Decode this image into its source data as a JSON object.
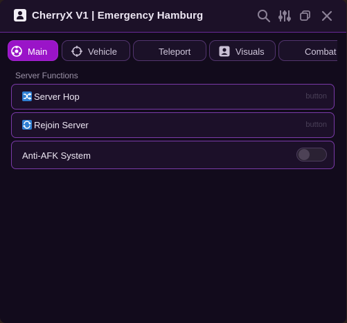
{
  "window": {
    "title": "CherryX V1 | Emergency Hamburg",
    "accent_color": "#9a14c8"
  },
  "titlebar_icons": [
    "search-icon",
    "settings-sliders-icon",
    "minimize-icon",
    "close-icon"
  ],
  "tabs": [
    {
      "label": "Main",
      "icon": "main-icon",
      "active": true
    },
    {
      "label": "Vehicle",
      "icon": "crosshair-icon",
      "active": false
    },
    {
      "label": "Teleport",
      "icon": "",
      "active": false
    },
    {
      "label": "Visuals",
      "icon": "user-card-icon",
      "active": false
    },
    {
      "label": "Combat",
      "icon": "",
      "active": false
    }
  ],
  "section": {
    "title": "Server Functions",
    "items": [
      {
        "label": "Server Hop",
        "type_hint": "button",
        "emoji": "shuffle-emoji-icon"
      },
      {
        "label": "Rejoin Server",
        "type_hint": "button",
        "emoji": "repeat-emoji-icon"
      },
      {
        "label": "Anti-AFK System",
        "type": "toggle",
        "value": false
      }
    ]
  }
}
